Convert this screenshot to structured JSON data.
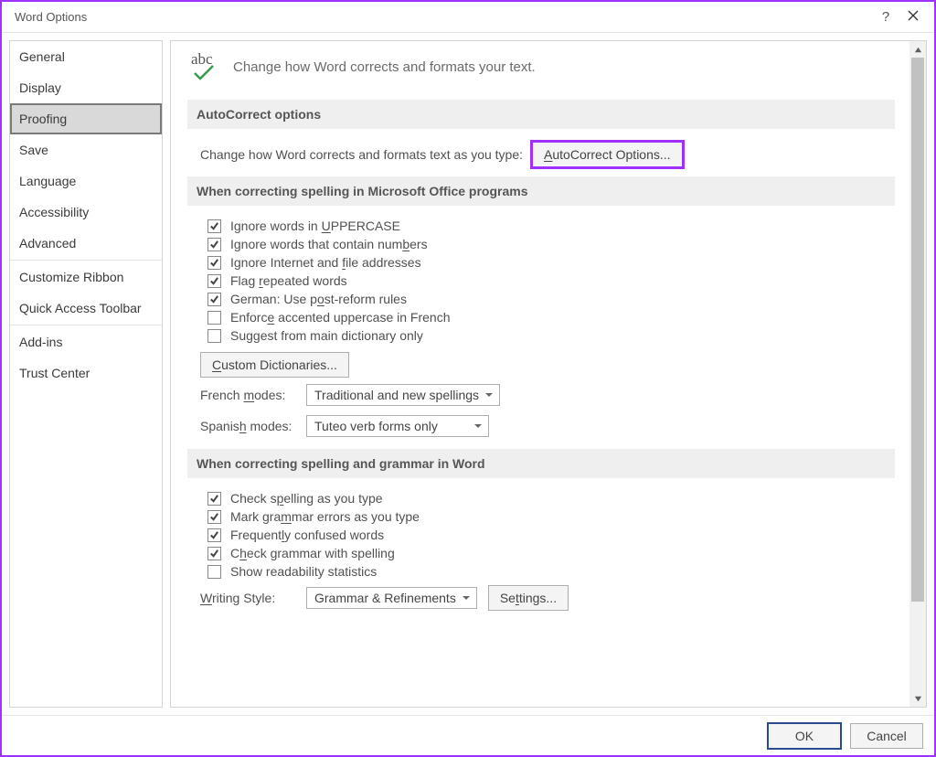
{
  "title": "Word Options",
  "nav": {
    "items": [
      "General",
      "Display",
      "Proofing",
      "Save",
      "Language",
      "Accessibility",
      "Advanced",
      "Customize Ribbon",
      "Quick Access Toolbar",
      "Add-ins",
      "Trust Center"
    ],
    "selected": "Proofing"
  },
  "header": {
    "iconText": "abc",
    "text": "Change how Word corrects and formats your text."
  },
  "sections": {
    "autocorrect": {
      "title": "AutoCorrect options",
      "desc": "Change how Word corrects and formats text as you type:",
      "button": {
        "pre": "A",
        "und": "u",
        "post": "toCorrect Options..."
      }
    },
    "spelling_office": {
      "title": "When correcting spelling in Microsoft Office programs",
      "checks": [
        {
          "checked": true,
          "pre": "Ignore words in ",
          "und": "U",
          "post": "PPERCASE"
        },
        {
          "checked": true,
          "pre": "Ignore words that contain num",
          "und": "b",
          "post": "ers"
        },
        {
          "checked": true,
          "pre": "Ignore Internet and ",
          "und": "f",
          "post": "ile addresses"
        },
        {
          "checked": true,
          "pre": "Flag ",
          "und": "r",
          "post": "epeated words"
        },
        {
          "checked": true,
          "pre": "German: Use p",
          "und": "o",
          "post": "st-reform rules"
        },
        {
          "checked": false,
          "pre": "Enforc",
          "und": "e",
          "post": " accented uppercase in French"
        },
        {
          "checked": false,
          "pre": "Suggest from main dictionary only",
          "und": "",
          "post": ""
        }
      ],
      "customDict": {
        "und": "C",
        "post": "ustom Dictionaries..."
      },
      "french": {
        "label_pre": "French ",
        "label_und": "m",
        "label_post": "odes:",
        "value": "Traditional and new spellings"
      },
      "spanish": {
        "label_pre": "Spanis",
        "label_und": "h",
        "label_post": " modes:",
        "value": "Tuteo verb forms only"
      }
    },
    "spelling_word": {
      "title": "When correcting spelling and grammar in Word",
      "checks": [
        {
          "checked": true,
          "pre": "Check s",
          "und": "p",
          "post": "elling as you type"
        },
        {
          "checked": true,
          "pre": "Mark gra",
          "und": "m",
          "post": "mar errors as you type"
        },
        {
          "checked": true,
          "pre": "Frequent",
          "und": "l",
          "post": "y confused words"
        },
        {
          "checked": true,
          "pre": "C",
          "und": "h",
          "post": "eck grammar with spelling"
        },
        {
          "checked": false,
          "pre": "Show readability statistics",
          "und": "",
          "post": ""
        }
      ],
      "writing": {
        "label_und": "W",
        "label_post": "riting Style:",
        "value": "Grammar & Refinements"
      },
      "settingsBtn": {
        "pre": "Se",
        "und": "t",
        "post": "tings..."
      }
    }
  },
  "footer": {
    "ok": "OK",
    "cancel": "Cancel"
  }
}
